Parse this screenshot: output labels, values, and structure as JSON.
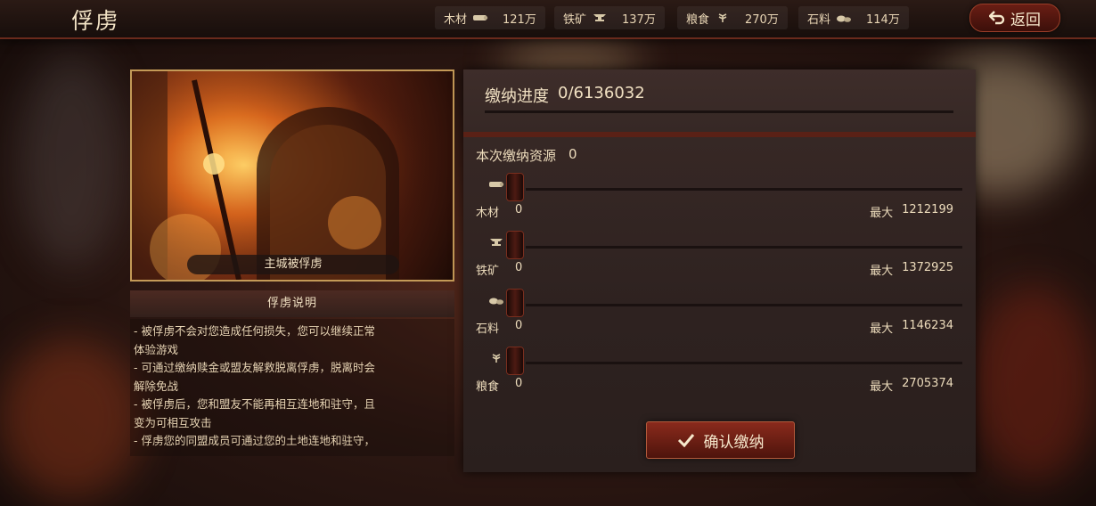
{
  "header": {
    "title": "俘虏",
    "back_label": "返回",
    "resources": [
      {
        "name": "木材",
        "icon": "wood-icon",
        "value": "121万"
      },
      {
        "name": "铁矿",
        "icon": "iron-anvil-icon",
        "value": "137万"
      },
      {
        "name": "粮食",
        "icon": "grain-icon",
        "value": "270万"
      },
      {
        "name": "石料",
        "icon": "stone-icon",
        "value": "114万"
      }
    ]
  },
  "hero": {
    "caption": "主城被俘虏"
  },
  "description": {
    "title": "俘虏说明",
    "lines": [
      "- 被俘虏不会对您造成任何损失，您可以继续正常",
      "体验游戏",
      "- 可通过缴纳赎金或盟友解救脱离俘虏，脱离时会",
      "解除免战",
      "- 被俘虏后，您和盟友不能再相互连地和驻守，且",
      "变为可相互攻击",
      "- 俘虏您的同盟成员可通过您的土地连地和驻守，"
    ]
  },
  "panel": {
    "progress_label": "缴纳进度",
    "progress_value": "0/6136032",
    "progress_fraction": 0,
    "current_label": "本次缴纳资源",
    "current_value": "0",
    "max_label": "最大",
    "rows": [
      {
        "name": "木材",
        "icon": "wood-icon",
        "value": "0",
        "max": "1212199"
      },
      {
        "name": "铁矿",
        "icon": "iron-anvil-icon",
        "value": "0",
        "max": "1372925"
      },
      {
        "name": "石料",
        "icon": "stone-icon",
        "value": "0",
        "max": "1146234"
      },
      {
        "name": "粮食",
        "icon": "grain-icon",
        "value": "0",
        "max": "2705374"
      }
    ],
    "confirm_label": "确认缴纳"
  },
  "colors": {
    "accent_red": "#8a2a1c",
    "gold_border": "#c49a57",
    "text": "#e9d6b5"
  }
}
